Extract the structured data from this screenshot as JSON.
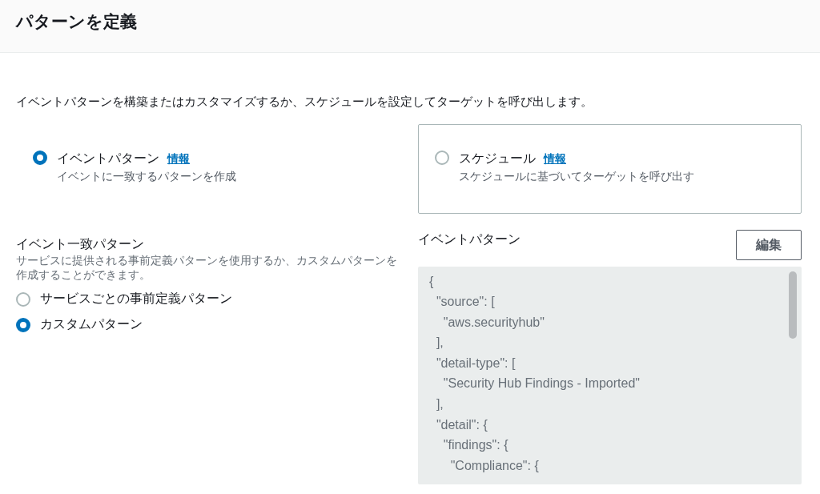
{
  "header": {
    "title": "パターンを定義"
  },
  "description": "イベントパターンを構築またはカスタマイズするか、スケジュールを設定してターゲットを呼び出します。",
  "rule_types": [
    {
      "label": "イベントパターン",
      "info": "情報",
      "hint": "イベントに一致するパターンを作成",
      "selected": true
    },
    {
      "label": "スケジュール",
      "info": "情報",
      "hint": "スケジュールに基づいてターゲットを呼び出す",
      "selected": false
    }
  ],
  "match": {
    "title": "イベント一致パターン",
    "hint": "サービスに提供される事前定義パターンを使用するか、カスタムパターンを作成することができます。",
    "options": [
      {
        "label": "サービスごとの事前定義パターン",
        "selected": false
      },
      {
        "label": "カスタムパターン",
        "selected": true
      }
    ]
  },
  "pattern": {
    "title": "イベントパターン",
    "edit_button": "編集",
    "lines": [
      "{",
      "  \"source\": [",
      "    \"aws.securityhub\"",
      "  ],",
      "  \"detail-type\": [",
      "    \"Security Hub Findings - Imported\"",
      "  ],",
      "  \"detail\": {",
      "    \"findings\": {",
      "      \"Compliance\": {"
    ]
  }
}
